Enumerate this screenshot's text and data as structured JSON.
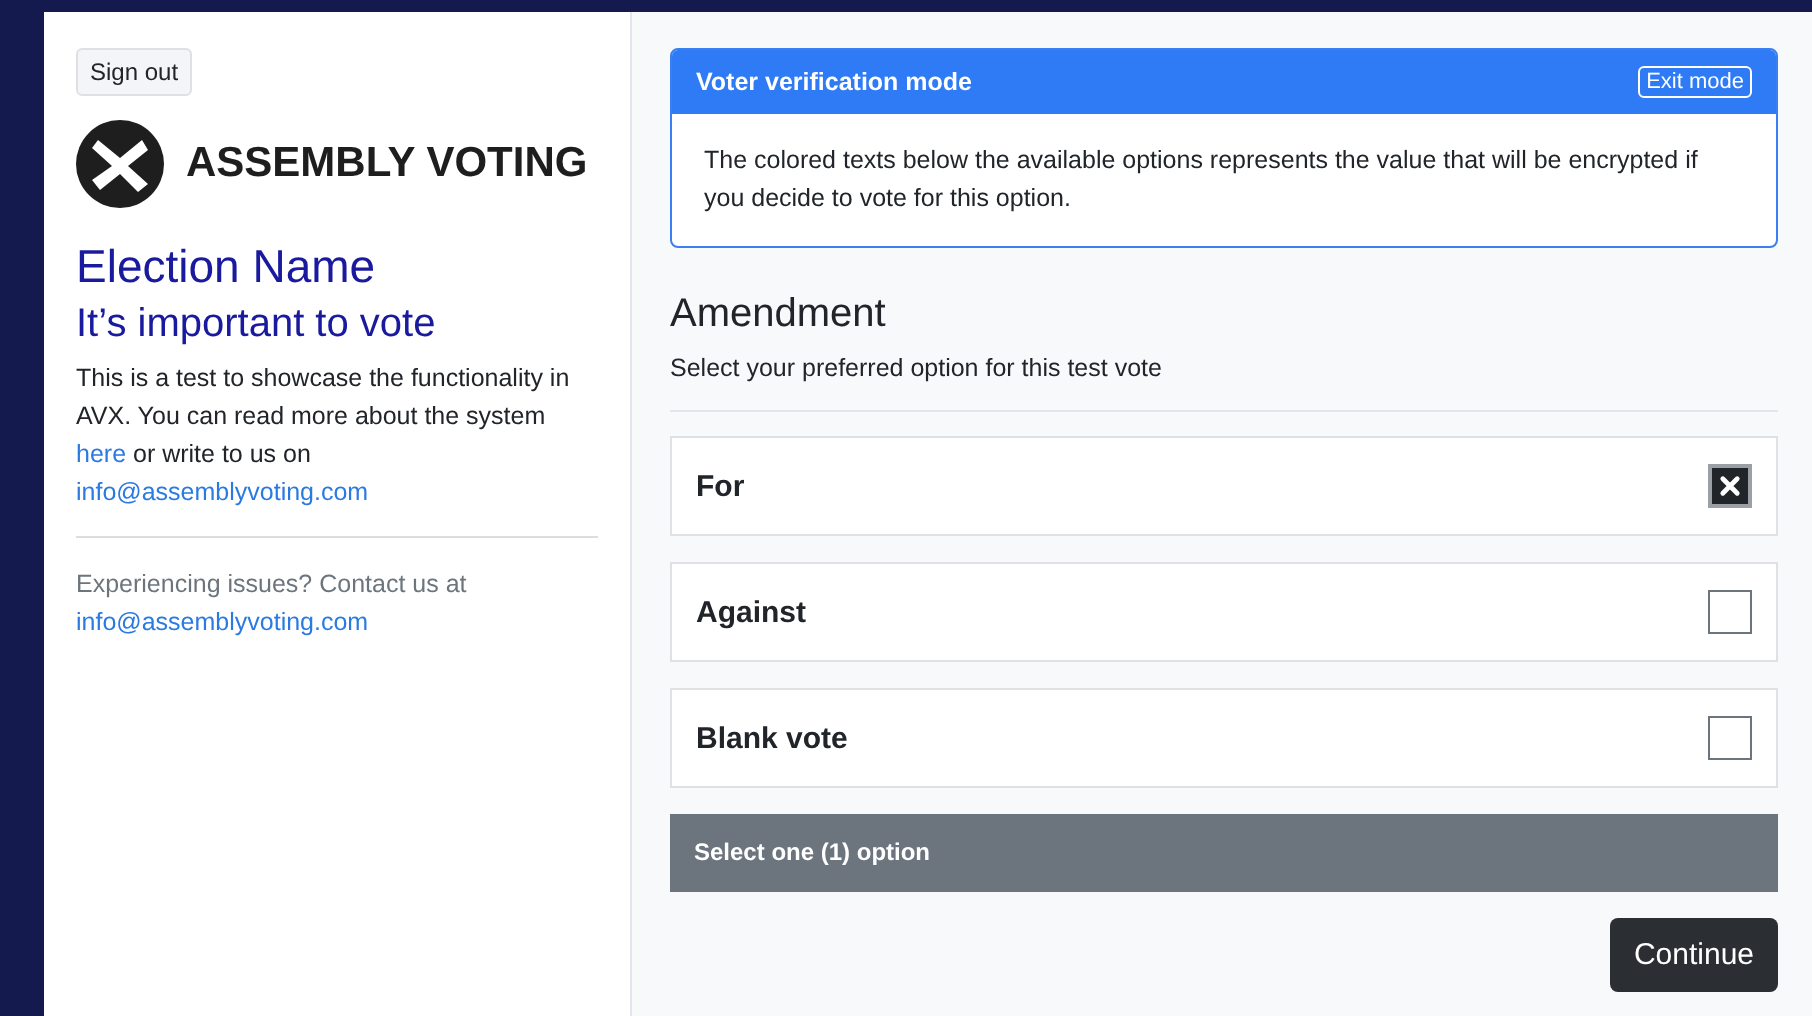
{
  "sidebar": {
    "sign_out": "Sign out",
    "logo_text": "ASSEMBLY VOTING",
    "election_name": "Election Name",
    "subtitle": "It’s important to vote",
    "intro": {
      "text": "This is a test to showcase the functionality in AVX. You can read more about the system",
      "link": "here",
      "text_after": "or write to us on",
      "email": "info@assemblyvoting.com"
    },
    "support": {
      "text": "Experiencing issues? Contact us at",
      "email": "info@assemblyvoting.com"
    }
  },
  "verification": {
    "title": "Voter verification mode",
    "exit_button": "Exit mode",
    "message": "The colored texts below the available options represents the value that will be encrypted if you decide to vote for this option."
  },
  "contest": {
    "title": "Amendment",
    "description": "Select your preferred option for this test vote",
    "options": [
      {
        "label": "For",
        "checked": true
      },
      {
        "label": "Against",
        "checked": false
      },
      {
        "label": "Blank vote",
        "checked": false
      }
    ],
    "status": "Select one (1) option"
  },
  "continue_button": "Continue"
}
